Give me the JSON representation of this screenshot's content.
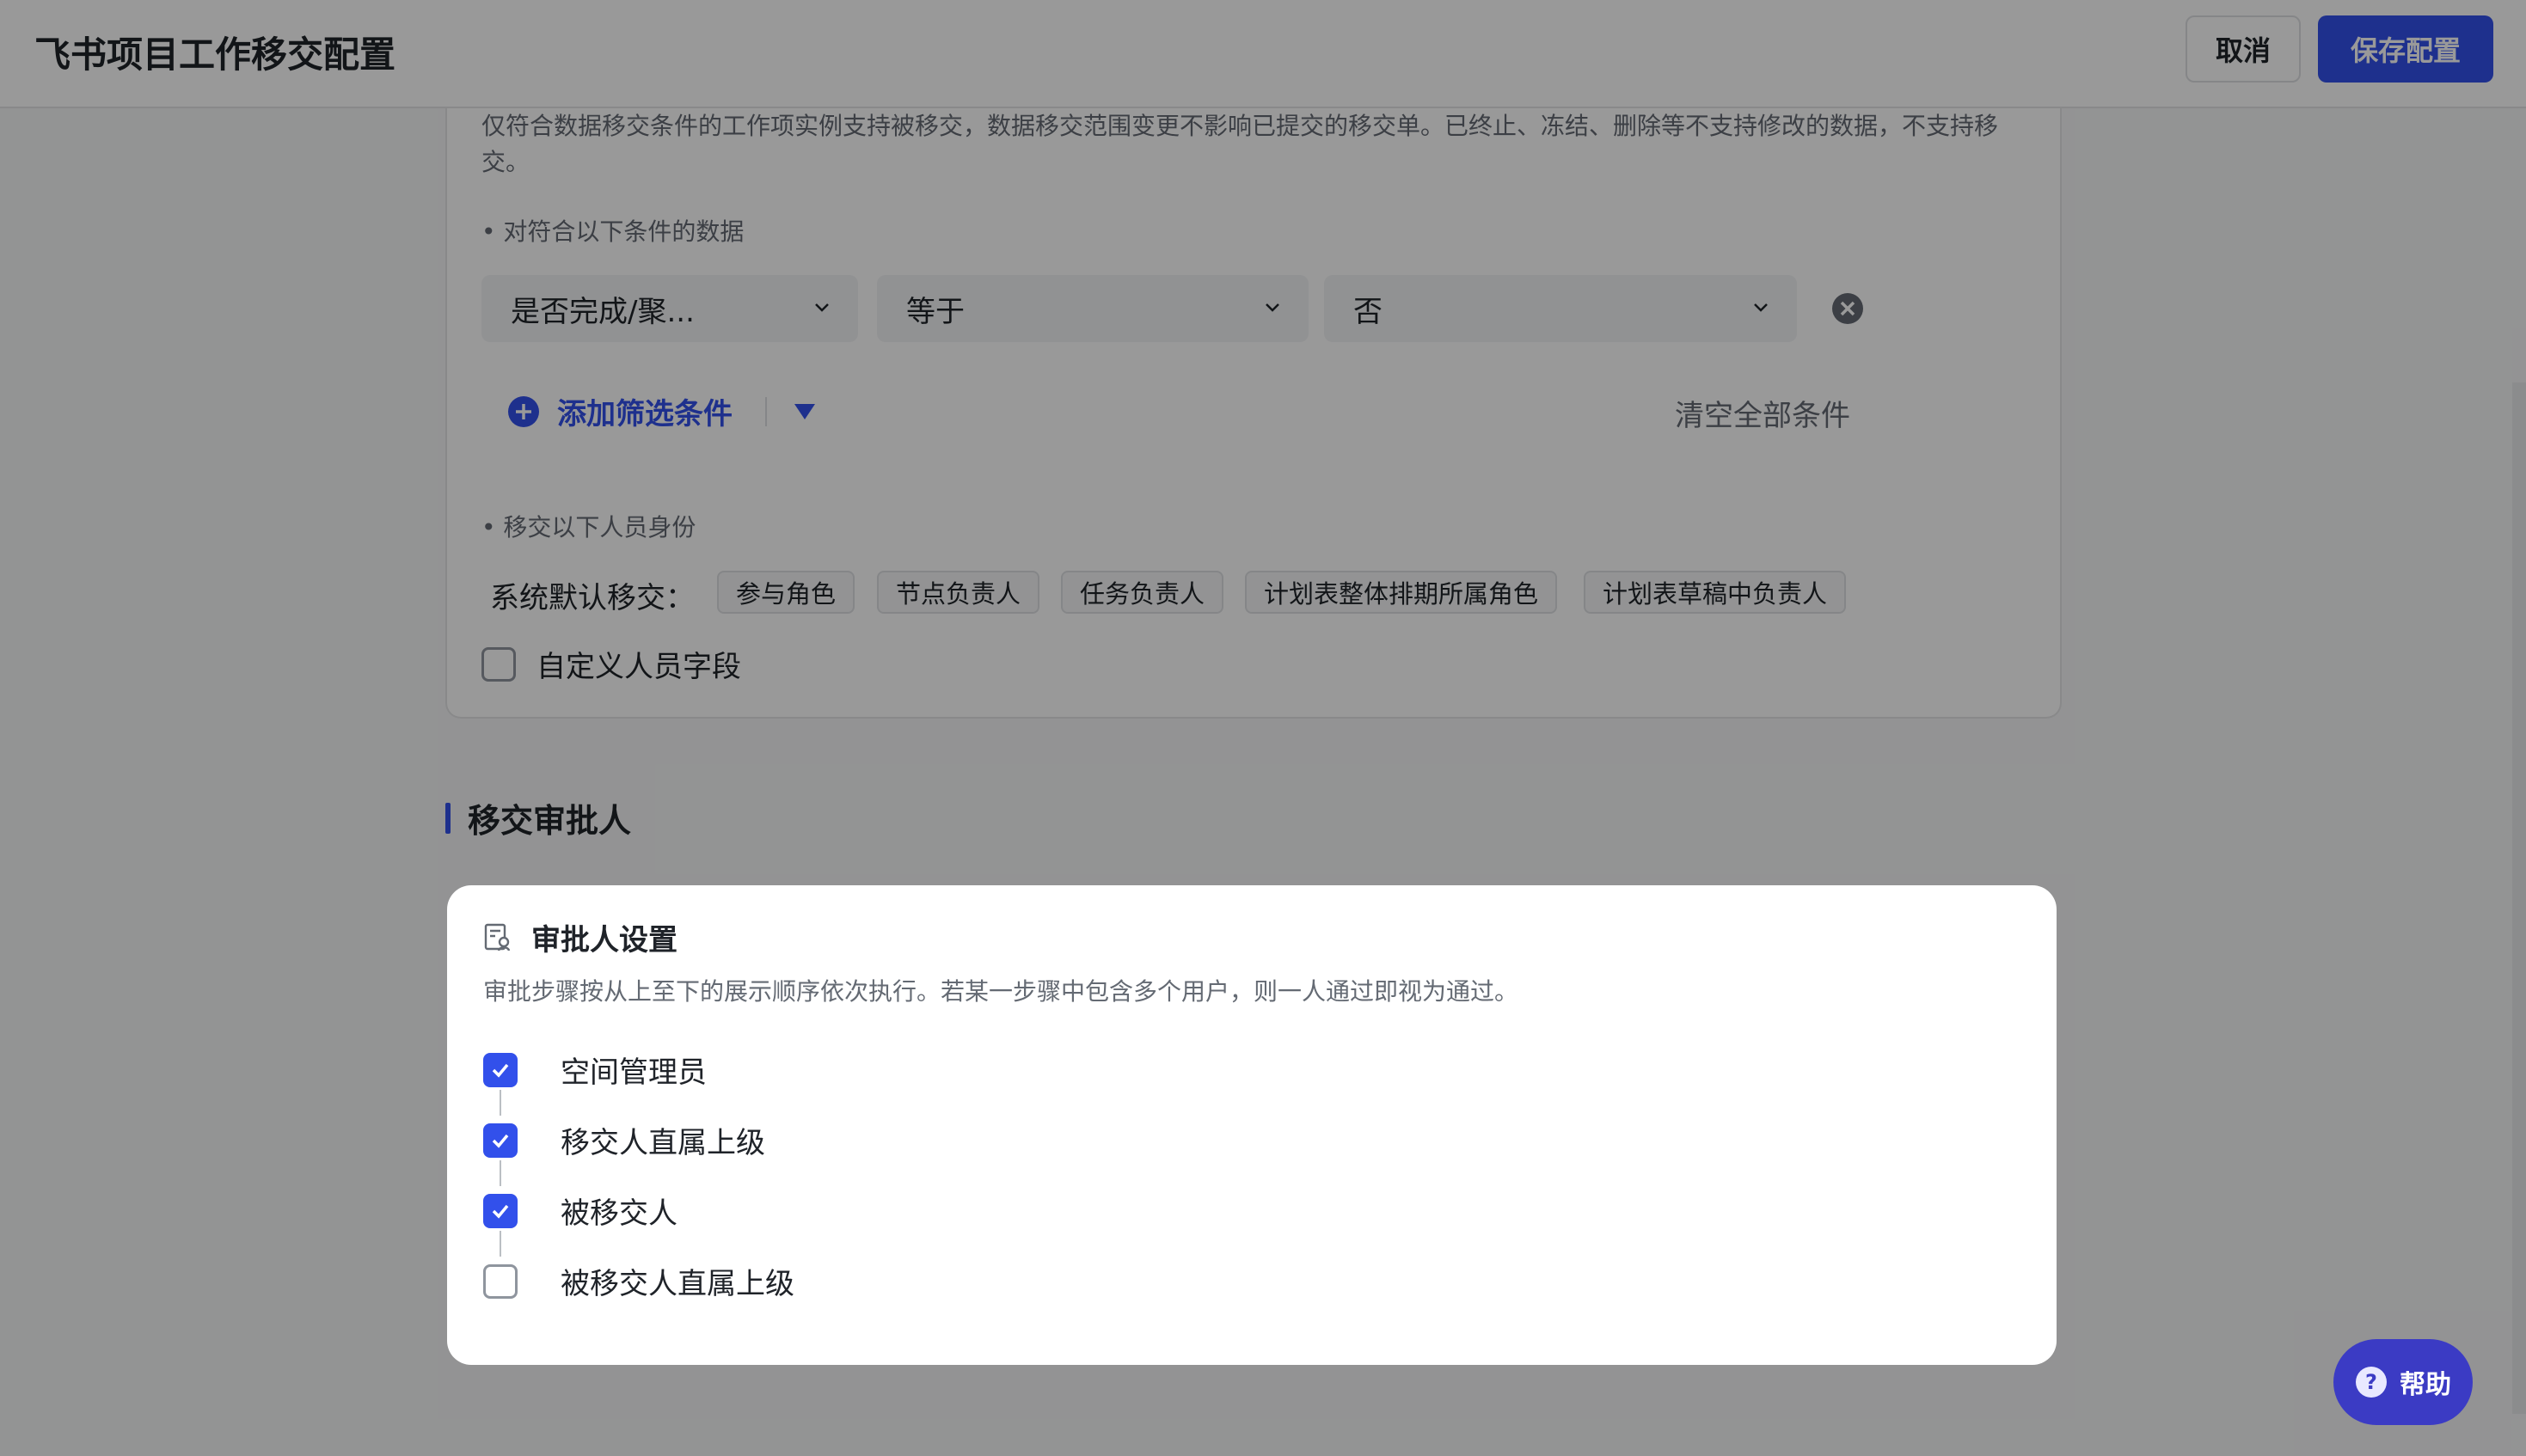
{
  "header": {
    "title": "飞书项目工作移交配置",
    "cancel_label": "取消",
    "save_label": "保存配置"
  },
  "scope": {
    "description": "仅符合数据移交条件的工作项实例支持被移交，数据移交范围变更不影响已提交的移交单。已终止、冻结、删除等不支持修改的数据，不支持移交。",
    "condition_heading": "• 对符合以下条件的数据",
    "filter": {
      "field": "是否完成/聚...",
      "operator": "等于",
      "value": "否"
    },
    "add_filter_label": "添加筛选条件",
    "clear_all_label": "清空全部条件"
  },
  "roles": {
    "heading": "• 移交以下人员身份",
    "system_default_label": "系统默认移交：",
    "tags": [
      "参与角色",
      "节点负责人",
      "任务负责人",
      "计划表整体排期所属角色",
      "计划表草稿中负责人"
    ],
    "custom_field_label": "自定义人员字段",
    "custom_field_checked": false
  },
  "approver_section": {
    "title": "移交审批人"
  },
  "approver_card": {
    "title": "审批人设置",
    "description": "审批步骤按从上至下的展示顺序依次执行。若某一步骤中包含多个用户，则一人通过即视为通过。",
    "steps": [
      {
        "label": "空间管理员",
        "checked": true
      },
      {
        "label": "移交人直属上级",
        "checked": true
      },
      {
        "label": "被移交人",
        "checked": true
      },
      {
        "label": "被移交人直属上级",
        "checked": false
      }
    ]
  },
  "help": {
    "label": "帮助"
  },
  "colors": {
    "accent": "#3250eb",
    "overlay": "rgba(0,0,0,0.4)"
  }
}
